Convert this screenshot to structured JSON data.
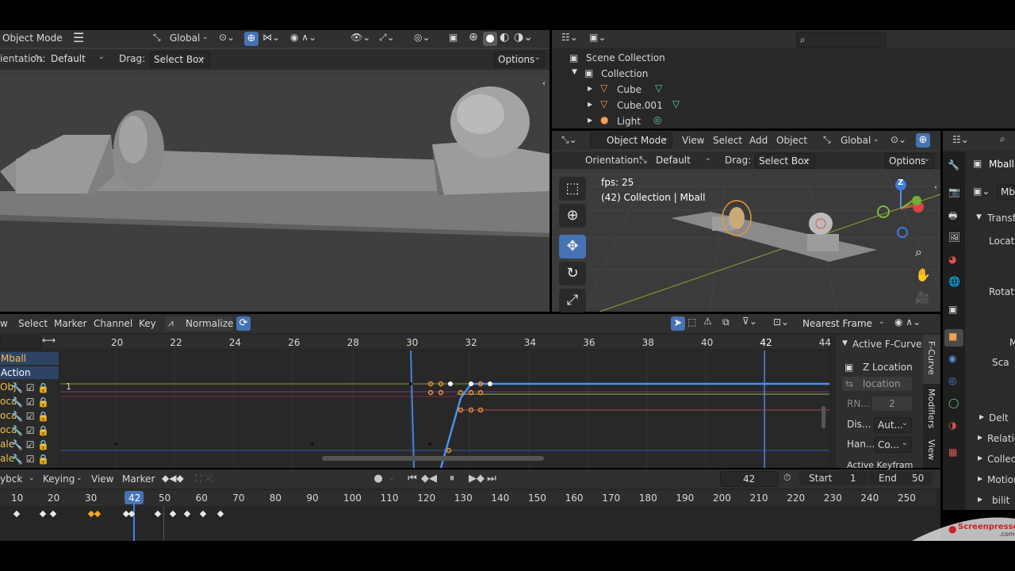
{
  "viewport_left": {
    "mode": "Object Mode",
    "transform": "Global",
    "orientation_label": "ientation:",
    "orientation_value": "Default",
    "drag_label": "Drag:",
    "drag_value": "Select Box",
    "options": "Options"
  },
  "outliner": {
    "items": [
      {
        "label": "Scene Collection"
      },
      {
        "label": "Collection"
      },
      {
        "label": "Cube"
      },
      {
        "label": "Cube.001"
      },
      {
        "label": "Light"
      }
    ]
  },
  "viewport_right": {
    "mode": "Object Mode",
    "menu": [
      "View",
      "Select",
      "Add",
      "Object"
    ],
    "transform": "Global",
    "orientation_label": "Orientation:",
    "orientation_value": "Default",
    "drag_label": "Drag:",
    "drag_value": "Select Box",
    "options": "Options",
    "fps": "fps: 25",
    "info": "(42) Collection | Mball",
    "axis_z": "Z"
  },
  "properties": {
    "object_name": "Mball",
    "object_field": "Mbal",
    "panels": [
      "Transfo",
      "Locatio",
      "Rotatio",
      "M",
      "Sca",
      "Delt",
      "Relatio",
      "Collect",
      "Motion",
      "bilit"
    ]
  },
  "graph_editor": {
    "menu": [
      "w",
      "Select",
      "Marker",
      "Channel",
      "Key"
    ],
    "normalize": "Normalize",
    "snap": "Nearest Frame",
    "ruler": [
      "20",
      "22",
      "24",
      "26",
      "28",
      "30",
      "32",
      "34",
      "36",
      "38",
      "40",
      "42",
      "44"
    ],
    "current_frame": "42",
    "channels": [
      {
        "label": "Mball"
      },
      {
        "label": "Action"
      },
      {
        "label": "Obj"
      },
      {
        "label": "oca"
      },
      {
        "label": "oca"
      },
      {
        "label": "oca"
      },
      {
        "label": "ale"
      },
      {
        "label": "ale"
      }
    ],
    "value_label": "1",
    "sidebar": {
      "active_fcurve": "Active F-Curve",
      "channel": "Z Location",
      "path": "location",
      "rna_label": "RN...",
      "rna_value": "2",
      "display_label": "Dis...",
      "display_value": "Aut...",
      "handle_label": "Han...",
      "handle_value": "Co...",
      "active_keyframe": "Active Keyfram"
    },
    "tabs": [
      "F-Curve",
      "Modifiers",
      "View"
    ]
  },
  "timeline": {
    "menu": [
      "ybck",
      "Keying",
      "View",
      "Marker"
    ],
    "current_frame": "42",
    "start_label": "Start",
    "start_value": "1",
    "end_label": "End",
    "end_value": "50",
    "ruler": [
      "10",
      "20",
      "30",
      "42",
      "50",
      "60",
      "70",
      "80",
      "90",
      "100",
      "110",
      "120",
      "130",
      "140",
      "150",
      "160",
      "170",
      "180",
      "190",
      "200",
      "210",
      "220",
      "230",
      "240",
      "250"
    ]
  },
  "watermark": {
    "brand": "Screenpresso",
    "domain": ".com"
  }
}
